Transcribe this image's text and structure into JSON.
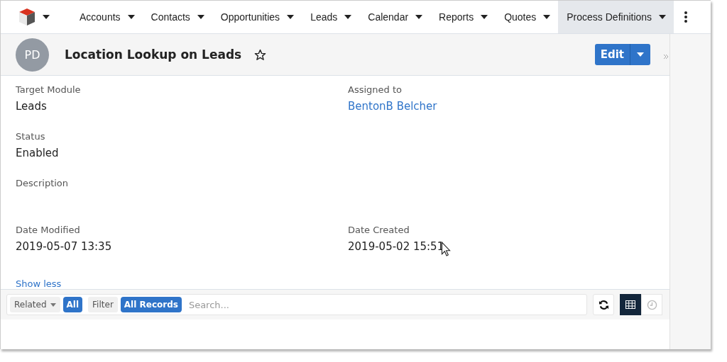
{
  "nav": {
    "items": [
      {
        "label": "Accounts",
        "selected": false
      },
      {
        "label": "Contacts",
        "selected": false
      },
      {
        "label": "Opportunities",
        "selected": false
      },
      {
        "label": "Leads",
        "selected": false
      },
      {
        "label": "Calendar",
        "selected": false
      },
      {
        "label": "Reports",
        "selected": false
      },
      {
        "label": "Quotes",
        "selected": false
      },
      {
        "label": "Process Definitions",
        "selected": true
      }
    ]
  },
  "record": {
    "avatar": "PD",
    "title": "Location Lookup on Leads",
    "favorite": false,
    "edit_button": "Edit"
  },
  "field_rows": [
    [
      {
        "label": "Target Module",
        "value": "Leads",
        "kind": "text"
      },
      {
        "label": "Assigned to",
        "value": "BentonB Belcher",
        "kind": "link"
      }
    ],
    [
      {
        "label": "Status",
        "value": "Enabled",
        "kind": "text"
      }
    ],
    [
      {
        "label": "Description"
      }
    ],
    [
      {
        "label": "Date Modified",
        "value": "2019-05-07 13:35",
        "kind": "text"
      },
      {
        "label": "Date Created",
        "value": "2019-05-02 15:51",
        "kind": "text"
      }
    ]
  ],
  "show_less": "Show less",
  "subpanel": {
    "related": "Related",
    "related_value": "All",
    "filter": "Filter",
    "filter_value": "All Records",
    "search": {
      "placeholder": "Search..."
    },
    "views": [
      {
        "kind": "list",
        "selected": true
      },
      {
        "kind": "activity",
        "selected": false
      }
    ]
  }
}
